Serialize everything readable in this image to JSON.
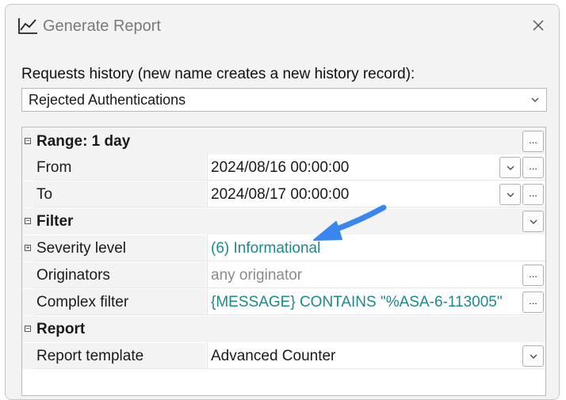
{
  "window": {
    "title": "Generate Report",
    "icon": "line-chart-icon",
    "close_icon": "close-icon"
  },
  "history": {
    "label": "Requests history (new name creates a new history record):",
    "value": "Rejected Authentications"
  },
  "grid": {
    "range": {
      "label": "Range: 1 day",
      "button": "...",
      "rows": [
        {
          "name": "From",
          "value": "2024/08/16 00:00:00",
          "button": "..."
        },
        {
          "name": "To",
          "value": "2024/08/17 00:00:00",
          "button": "..."
        }
      ]
    },
    "filter": {
      "label": "Filter",
      "rows": [
        {
          "name": "Severity level",
          "value": "(6) Informational"
        },
        {
          "name": "Originators",
          "value": "any originator",
          "button": "..."
        },
        {
          "name": "Complex filter",
          "value": "{MESSAGE} CONTAINS \"%ASA-6-113005\"",
          "button": "..."
        }
      ]
    },
    "report": {
      "label": "Report",
      "rows": [
        {
          "name": "Report template",
          "value": "Advanced Counter"
        }
      ]
    },
    "expand_symbol": "+",
    "collapse_symbol": "−"
  },
  "annotation": {
    "color": "#3a86f0",
    "icon": "callout-arrow-icon"
  }
}
